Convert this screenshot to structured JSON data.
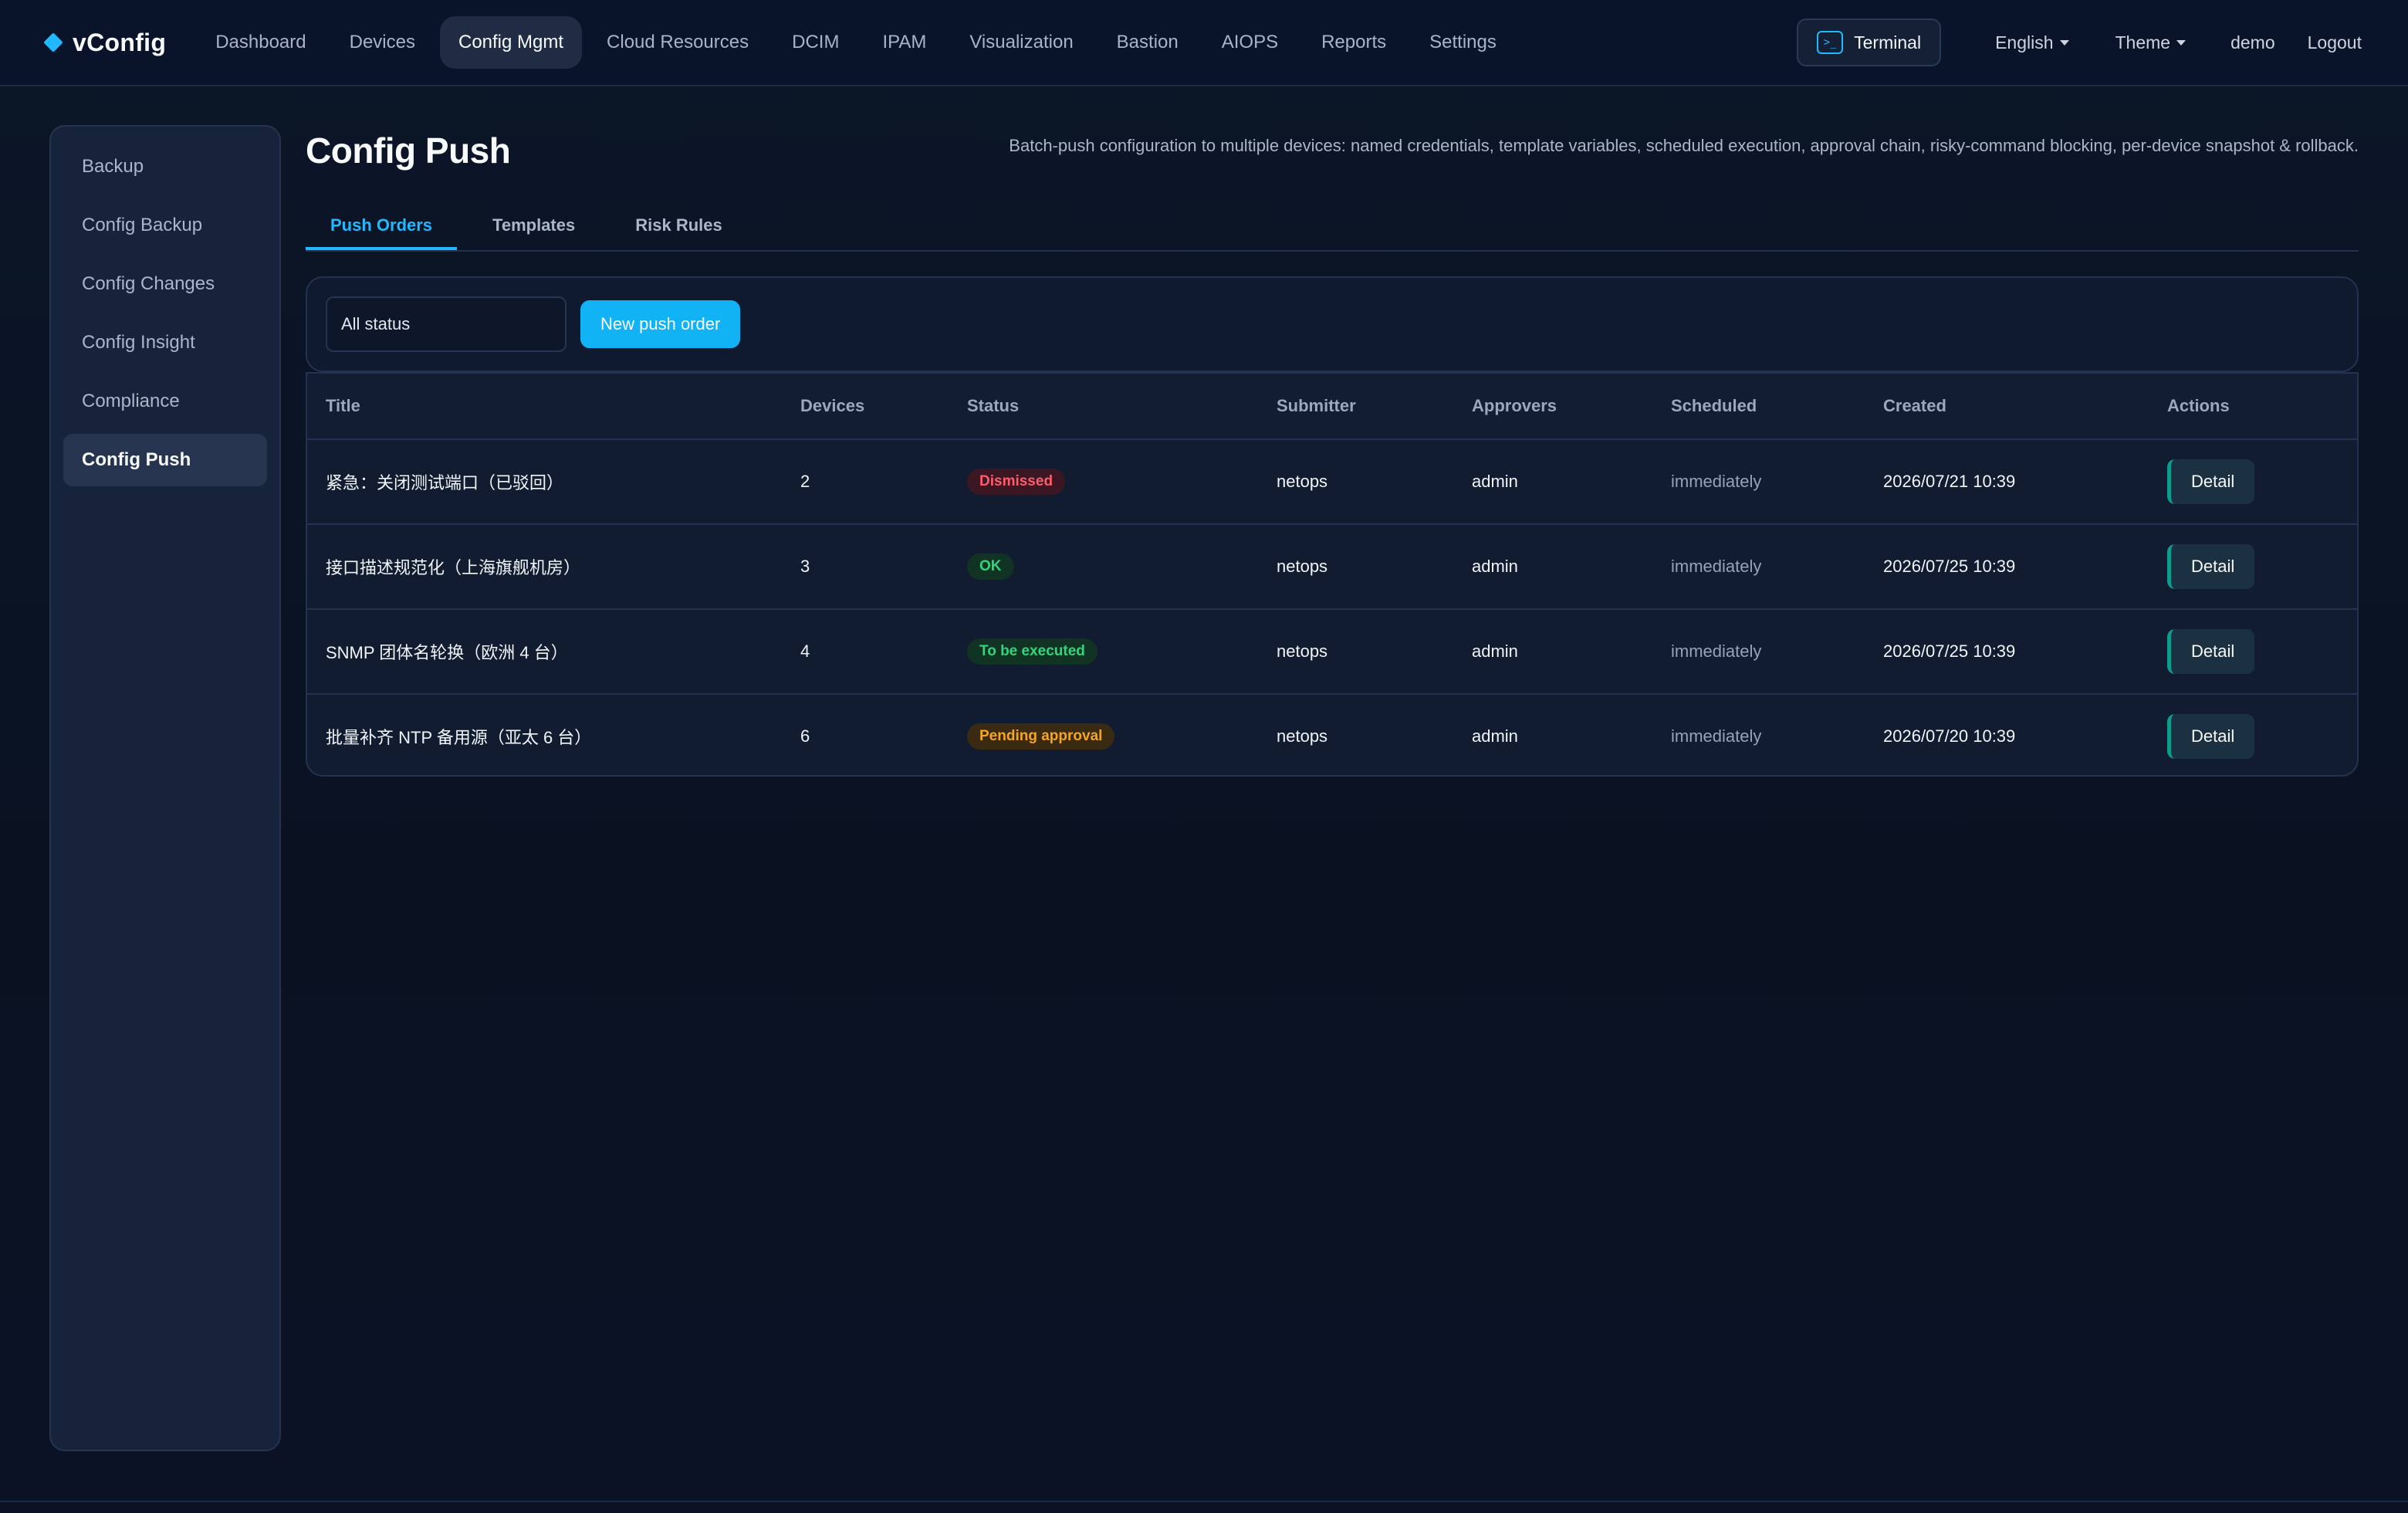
{
  "app": {
    "brand": "vConfig"
  },
  "nav": {
    "items": [
      {
        "label": "Dashboard",
        "active": false
      },
      {
        "label": "Devices",
        "active": false
      },
      {
        "label": "Config Mgmt",
        "active": true
      },
      {
        "label": "Cloud Resources",
        "active": false
      },
      {
        "label": "DCIM",
        "active": false
      },
      {
        "label": "IPAM",
        "active": false
      },
      {
        "label": "Visualization",
        "active": false
      },
      {
        "label": "Bastion",
        "active": false
      },
      {
        "label": "AIOPS",
        "active": false
      },
      {
        "label": "Reports",
        "active": false
      },
      {
        "label": "Settings",
        "active": false
      }
    ],
    "terminal_label": "Terminal",
    "terminal_icon_glyph": ">_",
    "language": "English",
    "theme": "Theme",
    "user": "demo",
    "logout": "Logout"
  },
  "sidebar": {
    "items": [
      {
        "label": "Backup",
        "active": false
      },
      {
        "label": "Config Backup",
        "active": false
      },
      {
        "label": "Config Changes",
        "active": false
      },
      {
        "label": "Config Insight",
        "active": false
      },
      {
        "label": "Compliance",
        "active": false
      },
      {
        "label": "Config Push",
        "active": true
      }
    ]
  },
  "page": {
    "title": "Config Push",
    "description": "Batch-push configuration to multiple devices: named credentials, template variables, scheduled execution, approval chain, risky-command blocking, per-device snapshot & rollback."
  },
  "tabs": [
    {
      "label": "Push Orders",
      "active": true
    },
    {
      "label": "Templates",
      "active": false
    },
    {
      "label": "Risk Rules",
      "active": false
    }
  ],
  "toolbar": {
    "status_filter": "All status",
    "new_button": "New push order"
  },
  "table": {
    "headers": {
      "title": "Title",
      "devices": "Devices",
      "status": "Status",
      "submitter": "Submitter",
      "approvers": "Approvers",
      "scheduled": "Scheduled",
      "created": "Created",
      "actions": "Actions"
    },
    "rows": [
      {
        "title": "紧急：关闭测试端口（已驳回）",
        "devices": "2",
        "status": "Dismissed",
        "status_color": "#ff5b6e",
        "submitter": "netops",
        "approvers": "admin",
        "scheduled": "immediately",
        "created": "2026/07/21 10:39",
        "action": "Detail"
      },
      {
        "title": "接口描述规范化（上海旗舰机房）",
        "devices": "3",
        "status": "OK",
        "status_color": "#2fd67c",
        "submitter": "netops",
        "approvers": "admin",
        "scheduled": "immediately",
        "created": "2026/07/25 10:39",
        "action": "Detail"
      },
      {
        "title": "SNMP 团体名轮换（欧洲 4 台）",
        "devices": "4",
        "status": "To be executed",
        "status_color": "#2fd67c",
        "submitter": "netops",
        "approvers": "admin",
        "scheduled": "immediately",
        "created": "2026/07/25 10:39",
        "action": "Detail"
      },
      {
        "title": "批量补齐 NTP 备用源（亚太 6 台）",
        "devices": "6",
        "status": "Pending approval",
        "status_color": "#f5a524",
        "submitter": "netops",
        "approvers": "admin",
        "scheduled": "immediately",
        "created": "2026/07/20 10:39",
        "action": "Detail"
      }
    ]
  },
  "colors": {
    "accent": "#22b8ff",
    "primary_button": "#12b3f5",
    "background": "#0a1222"
  }
}
